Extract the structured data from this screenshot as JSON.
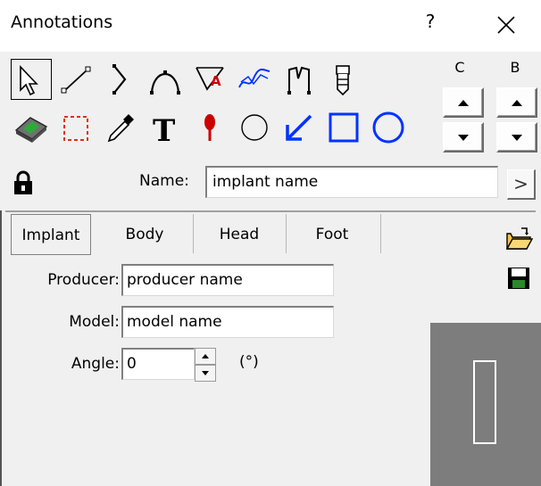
{
  "window": {
    "title": "Annotations",
    "help_label": "?"
  },
  "toolbar": {
    "row1": [
      "select-arrow-icon",
      "line-icon",
      "angle-bracket-icon",
      "arc-icon",
      "annotated-angle-icon",
      "freehand-curve-icon",
      "measure-bracket-icon",
      "implant-screw-icon"
    ],
    "row2": [
      "eraser-icon",
      "rectangle-select-icon",
      "eyedropper-icon",
      "text-icon",
      "pin-marker-icon",
      "circle-outline-icon",
      "blue-arrow-icon",
      "blue-square-icon",
      "blue-circle-icon"
    ],
    "selected_tool": "select-arrow-icon",
    "accent_color": "#0033ff",
    "marker_color": "#cc0000"
  },
  "columns": {
    "c_label": "C",
    "b_label": "B"
  },
  "name_field": {
    "label": "Name:",
    "value": "implant name",
    "next_label": ">"
  },
  "tabs": [
    {
      "label": "Implant",
      "active": true
    },
    {
      "label": "Body",
      "active": false
    },
    {
      "label": "Head",
      "active": false
    },
    {
      "label": "Foot",
      "active": false
    }
  ],
  "form": {
    "producer_label": "Producer:",
    "producer_value": "producer name",
    "model_label": "Model:",
    "model_value": "model name",
    "angle_label": "Angle:",
    "angle_value": "0",
    "angle_unit": "(°)"
  },
  "preview": {
    "background": "#7d7d7d"
  }
}
